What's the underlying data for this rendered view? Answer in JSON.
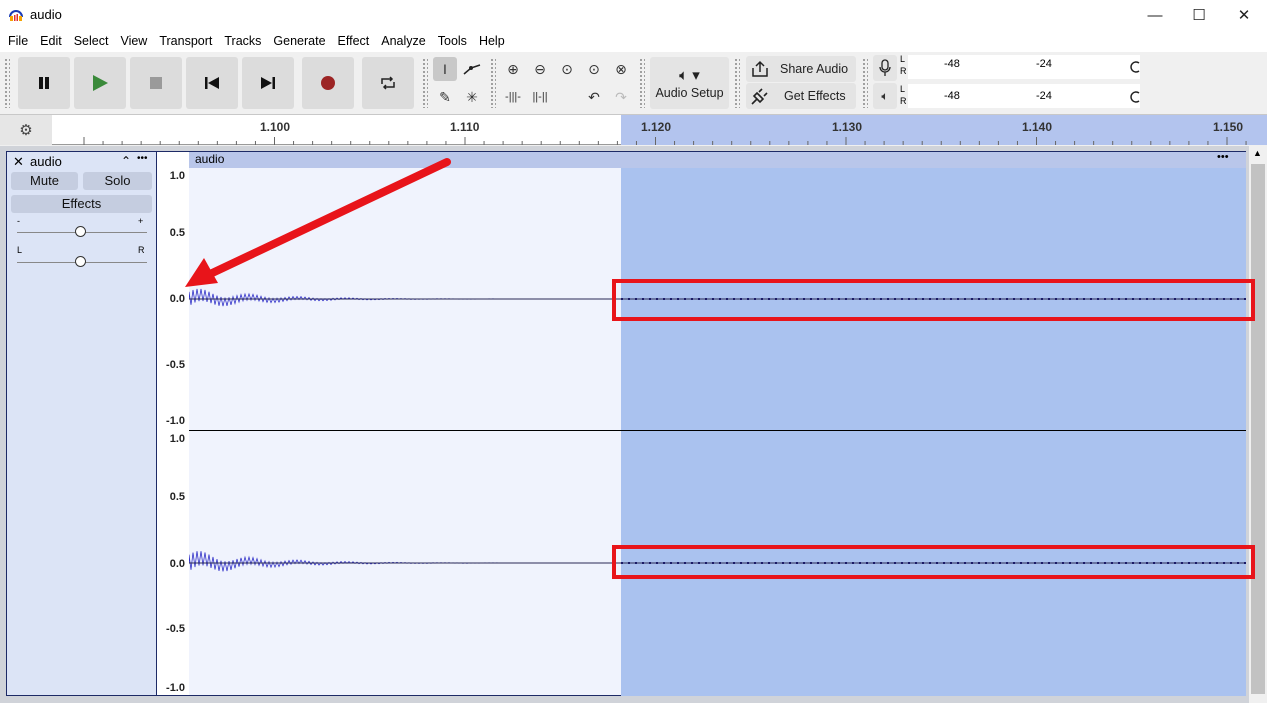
{
  "app": {
    "title": "audio",
    "minimize": "—",
    "maximize": "☐",
    "close": "✕"
  },
  "menu": [
    "File",
    "Edit",
    "Select",
    "View",
    "Transport",
    "Tracks",
    "Generate",
    "Effect",
    "Analyze",
    "Tools",
    "Help"
  ],
  "toolbar": {
    "audio_setup_label": "Audio Setup",
    "share_audio_label": "Share Audio",
    "get_effects_label": "Get Effects",
    "meter_ticks": [
      "-48",
      "-24"
    ],
    "meter_channels": [
      "L",
      "R"
    ]
  },
  "ruler": {
    "ticks": [
      "1.100",
      "1.110",
      "1.120",
      "1.130",
      "1.140",
      "1.150"
    ]
  },
  "track": {
    "name": "audio",
    "mute_label": "Mute",
    "solo_label": "Solo",
    "effects_label": "Effects",
    "gain_minus": "-",
    "gain_plus": "+",
    "pan_left": "L",
    "pan_right": "R",
    "clip_name": "audio",
    "clip_menu": "•••",
    "menu_glyph": "•••"
  },
  "vruler": {
    "ch1": [
      "1.0",
      "0.5",
      "0.0",
      "-0.5",
      "-1.0"
    ],
    "ch2": [
      "1.0",
      "0.5",
      "0.0",
      "-0.5",
      "-1.0"
    ]
  },
  "colors": {
    "selection": "#aac2ef",
    "waveform": "#3232c8",
    "annotation": "#e8141a"
  }
}
